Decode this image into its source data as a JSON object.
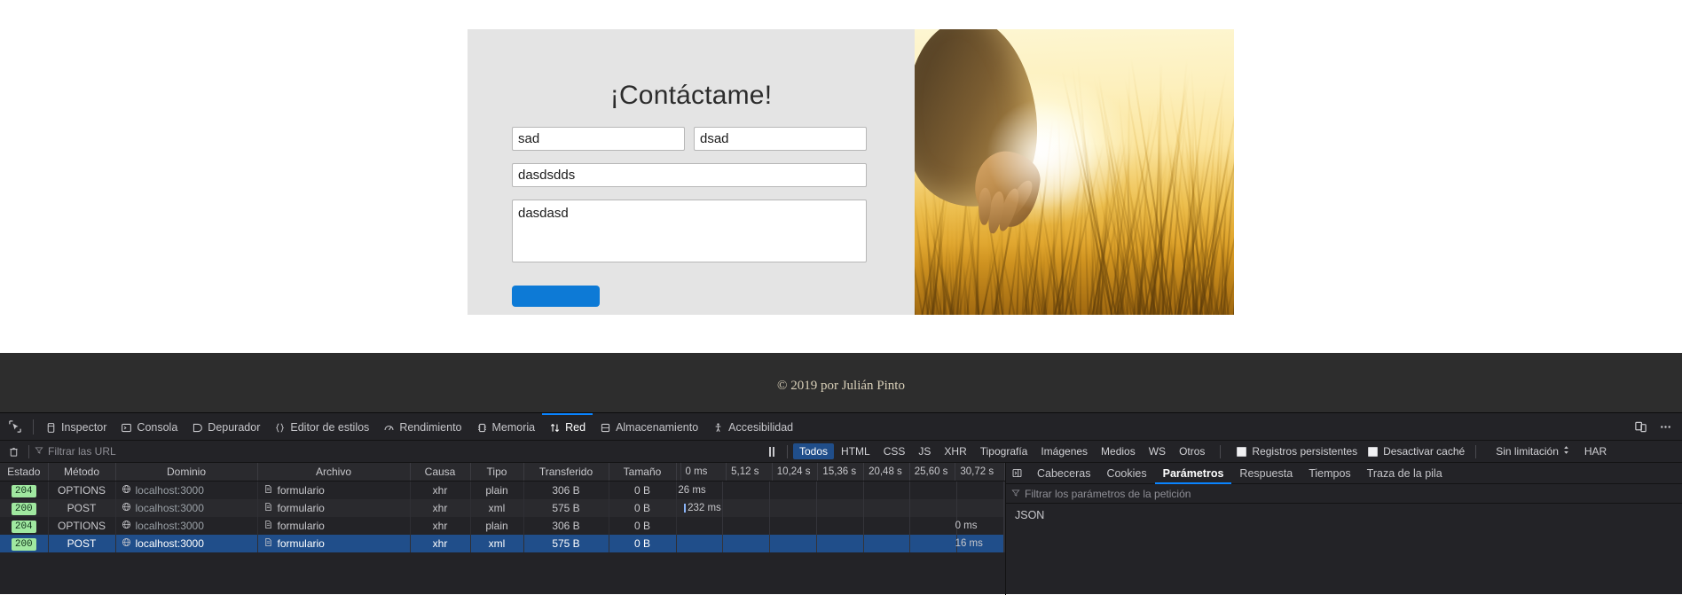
{
  "site": {
    "title": "¡Contáctame!",
    "fields": {
      "name_value": "sad",
      "name_placeholder": "",
      "lastname_value": "dsad",
      "lastname_placeholder": "",
      "subject_value": "dasdsdds",
      "subject_placeholder": "",
      "message_value": "dasdasd",
      "message_placeholder": ""
    },
    "submit_label": "",
    "footer": "© 2019 por Julián Pinto",
    "photo_alt": "hand-touching-wheat-field-at-sunset"
  },
  "devtools": {
    "tabs": [
      {
        "label": "Inspector",
        "icon": "inspector-icon",
        "active": false
      },
      {
        "label": "Consola",
        "icon": "console-icon",
        "active": false
      },
      {
        "label": "Depurador",
        "icon": "debugger-icon",
        "active": false
      },
      {
        "label": "Editor de estilos",
        "icon": "style-editor-icon",
        "active": false
      },
      {
        "label": "Rendimiento",
        "icon": "performance-icon",
        "active": false
      },
      {
        "label": "Memoria",
        "icon": "memory-icon",
        "active": false
      },
      {
        "label": "Red",
        "icon": "network-icon",
        "active": true
      },
      {
        "label": "Almacenamiento",
        "icon": "storage-icon",
        "active": false
      },
      {
        "label": "Accesibilidad",
        "icon": "accessibility-icon",
        "active": false
      }
    ],
    "toolbar_right": {
      "responsive_icon": "responsive-design-mode-icon",
      "more_icon": "meatball-menu-icon"
    },
    "filterbar": {
      "clear_icon": "trash-icon",
      "url_filter_placeholder": "Filtrar las URL",
      "pause_icon": "pause-icon",
      "type_filters": [
        {
          "label": "Todos",
          "active": true
        },
        {
          "label": "HTML",
          "active": false
        },
        {
          "label": "CSS",
          "active": false
        },
        {
          "label": "JS",
          "active": false
        },
        {
          "label": "XHR",
          "active": false
        },
        {
          "label": "Tipografía",
          "active": false
        },
        {
          "label": "Imágenes",
          "active": false
        },
        {
          "label": "Medios",
          "active": false
        },
        {
          "label": "WS",
          "active": false
        },
        {
          "label": "Otros",
          "active": false
        }
      ],
      "persist_logs_label": "Registros persistentes",
      "persist_logs_checked": false,
      "disable_cache_label": "Desactivar caché",
      "disable_cache_checked": false,
      "throttling_label": "Sin limitación",
      "har_label": "HAR"
    },
    "table": {
      "columns": [
        "Estado",
        "Método",
        "Dominio",
        "Archivo",
        "Causa",
        "Tipo",
        "Transferido",
        "Tamaño"
      ],
      "timeline_ticks": [
        "0 ms",
        "5,12 s",
        "10,24 s",
        "15,36 s",
        "20,48 s",
        "25,60 s",
        "30,72 s"
      ],
      "rows": [
        {
          "status": "204",
          "method": "OPTIONS",
          "domain": "localhost:3000",
          "file": "formulario",
          "cause": "xhr",
          "type": "plain",
          "transferred": "306 B",
          "size": "0 B",
          "timing": "26 ms",
          "timing_left_pct": 0.5,
          "has_tick": false,
          "selected": false
        },
        {
          "status": "200",
          "method": "POST",
          "domain": "localhost:3000",
          "file": "formulario",
          "cause": "xhr",
          "type": "xml",
          "transferred": "575 B",
          "size": "0 B",
          "timing": "232 ms",
          "timing_left_pct": 2.2,
          "has_tick": true,
          "selected": false
        },
        {
          "status": "204",
          "method": "OPTIONS",
          "domain": "localhost:3000",
          "file": "formulario",
          "cause": "xhr",
          "type": "plain",
          "transferred": "306 B",
          "size": "0 B",
          "timing": "0 ms",
          "timing_left_pct": 85.0,
          "has_tick": false,
          "selected": false
        },
        {
          "status": "200",
          "method": "POST",
          "domain": "localhost:3000",
          "file": "formulario",
          "cause": "xhr",
          "type": "xml",
          "transferred": "575 B",
          "size": "0 B",
          "timing": "16 ms",
          "timing_left_pct": 85.0,
          "has_tick": false,
          "selected": true
        }
      ]
    },
    "details": {
      "toggle_icon": "panel-toggle-icon",
      "tabs": [
        {
          "label": "Cabeceras",
          "active": false
        },
        {
          "label": "Cookies",
          "active": false
        },
        {
          "label": "Parámetros",
          "active": true
        },
        {
          "label": "Respuesta",
          "active": false
        },
        {
          "label": "Tiempos",
          "active": false
        },
        {
          "label": "Traza de la pila",
          "active": false
        }
      ],
      "filter_placeholder": "Filtrar los parámetros de la petición",
      "section_label": "JSON"
    },
    "colors": {
      "accent": "#0a84ff",
      "selection": "#204e8a",
      "status_ok": "#a0e8a0",
      "panel_bg": "#232327"
    }
  }
}
